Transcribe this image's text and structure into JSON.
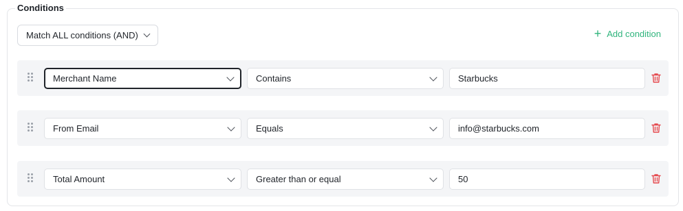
{
  "section": {
    "legend": "Conditions"
  },
  "match": {
    "label": "Match ALL conditions (AND)"
  },
  "add_condition": {
    "label": "Add condition",
    "color": "#2fb47c"
  },
  "rows": [
    {
      "field": "Merchant Name",
      "operator": "Contains",
      "value": "Starbucks"
    },
    {
      "field": "From Email",
      "operator": "Equals",
      "value": "info@starbucks.com"
    },
    {
      "field": "Total Amount",
      "operator": "Greater than or equal",
      "value": "50"
    }
  ],
  "icons": {
    "drag": "drag-handle-icon",
    "delete": "trash-icon",
    "delete_color": "#e5484d",
    "chevron": "chevron-down-icon",
    "add": "plus-icon"
  }
}
